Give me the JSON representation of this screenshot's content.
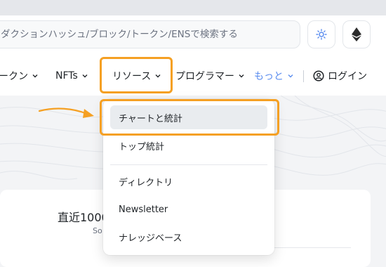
{
  "search": {
    "placeholder": "ダクションハッシュ/ブロック/トークン/ENSで検索する"
  },
  "header": {
    "theme_icon": "sun-icon",
    "network_icon": "ethereum-icon"
  },
  "nav": {
    "tokens": "ークン",
    "nfts": "NFTs",
    "resources": "リソース",
    "developers": "プログラマー",
    "more": "もっと",
    "login": "ログイン"
  },
  "dropdown": {
    "items": [
      {
        "label": "チャートと統計",
        "active": true
      },
      {
        "label": "トップ統計"
      },
      {
        "label": "ディレクトリ"
      },
      {
        "label": "Newsletter"
      },
      {
        "label": "ナレッジベース"
      }
    ]
  },
  "card": {
    "title": "直近1000",
    "subtitle": "So"
  },
  "colors": {
    "highlight": "#f5a023",
    "more_link": "#5b8def",
    "active_bg": "#e9ecef"
  }
}
